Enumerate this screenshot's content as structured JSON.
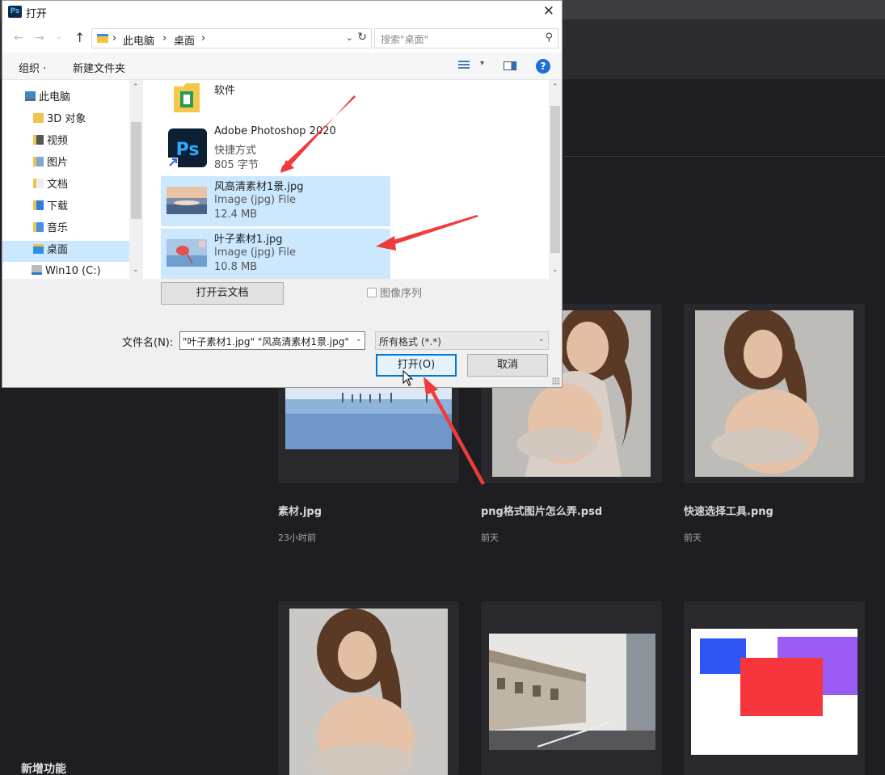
{
  "dialog": {
    "title": "打开",
    "app_icon": "Ps",
    "address": {
      "crumbs": [
        "此电脑",
        "桌面"
      ],
      "sep": "›"
    },
    "search_placeholder": "搜索\"桌面\"",
    "toolbar": {
      "organize": "组织 ·",
      "new_folder": "新建文件夹"
    },
    "nav_items": [
      {
        "label": "此电脑",
        "icon": "computer-icon"
      },
      {
        "label": "3D 对象",
        "icon": "3d-objects-icon"
      },
      {
        "label": "视频",
        "icon": "video-folder-icon"
      },
      {
        "label": "图片",
        "icon": "pictures-folder-icon"
      },
      {
        "label": "文档",
        "icon": "documents-folder-icon"
      },
      {
        "label": "下载",
        "icon": "downloads-folder-icon"
      },
      {
        "label": "音乐",
        "icon": "music-folder-icon"
      },
      {
        "label": "桌面",
        "icon": "desktop-folder-icon",
        "selected": true
      },
      {
        "label": "Win10 (C:)",
        "icon": "drive-icon"
      }
    ],
    "files": [
      {
        "name": "软件",
        "type": "",
        "size": "",
        "icon": "folder-icon",
        "selected": false
      },
      {
        "name": "Adobe Photoshop 2020",
        "type": "快捷方式",
        "size": "805 字节",
        "icon": "photoshop-shortcut-icon",
        "selected": false
      },
      {
        "name": "风高清素材1景.jpg",
        "type": "Image (jpg) File",
        "size": "12.4 MB",
        "icon": "landscape-thumbnail",
        "selected": true
      },
      {
        "name": "叶子素材1.jpg",
        "type": "Image (jpg) File",
        "size": "10.8 MB",
        "icon": "leaf-thumbnail",
        "selected": true
      }
    ],
    "open_cloud_label": "打开云文档",
    "image_sequence_label": "图像序列",
    "filename_label": "文件名(N):",
    "filename_value": "\"叶子素材1.jpg\" \"风高清素材1景.jpg\"",
    "filetype_value": "所有格式 (*.*)",
    "open_label": "打开(O)",
    "cancel_label": "取消"
  },
  "photoshop": {
    "recent_files": [
      {
        "name": "素材.jpg",
        "time": "23小时前"
      },
      {
        "name": "png格式图片怎么弄.psd",
        "time": "前天"
      },
      {
        "name": "快速选择工具.png",
        "time": "前天"
      }
    ],
    "new_features_label": "新增功能"
  },
  "colors": {
    "selection": "#cce8ff",
    "accent": "#0078d7",
    "annotation_arrow": "#ef3b3b",
    "ps_background": "#1e1d21"
  }
}
